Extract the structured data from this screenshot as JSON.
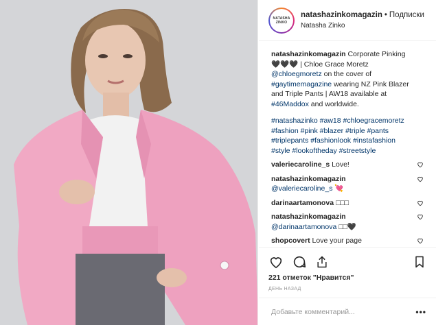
{
  "header": {
    "username": "natashazinkomagazin",
    "separator": "•",
    "follow_label": "Подписки",
    "location": "Natasha Zinko",
    "avatar_text": "NATASHA ZINKO"
  },
  "caption": {
    "username": "natashazinkomagazin",
    "parts": {
      "t1": "Corporate Pinking",
      "hearts": "🖤🖤🖤",
      "t2": "| Chloe Grace Moretz",
      "mention": "@chloegmoretz",
      "t3": "on the cover of",
      "tag1": "#gaytimemagazine",
      "t4": "wearing NZ Pink Blazer and Triple Pants | AW18 available at",
      "tag2": "#46Maddox",
      "t5": "and worldwide."
    }
  },
  "hashtags": {
    "line1": "#natashazinko #aw18 #chloegracemoretz",
    "line2": "#fashion #pink #blazer #triple #pants",
    "line3": "#triplepants #fashionlook #instafashion",
    "line4": "#style #lookoftheday #streetstyle"
  },
  "comments": [
    {
      "user": "valeriecaroline_s",
      "text": "Love!"
    },
    {
      "user": "natashazinkomagazin",
      "mention": "@valeriecaroline_s",
      "text": "💘"
    },
    {
      "user": "darinaartamonova",
      "text": "□□□"
    },
    {
      "user": "natashazinkomagazin",
      "mention": "@darinaartamonova",
      "text": "□□🖤"
    },
    {
      "user": "shopcovert",
      "text": "Love your page"
    }
  ],
  "actions": {
    "like_icon": "heart-icon",
    "comment_icon": "comment-icon",
    "share_icon": "share-icon",
    "save_icon": "bookmark-icon",
    "likes_text": "221 отметок \"Нравится\"",
    "time_text": "ДЕНЬ НАЗАД"
  },
  "add_comment": {
    "placeholder": "Добавьте комментарий...",
    "more": "•••"
  },
  "colors": {
    "blazer": "#f1a9c4",
    "hashtag": "#003569",
    "background": "#d6d7da"
  }
}
